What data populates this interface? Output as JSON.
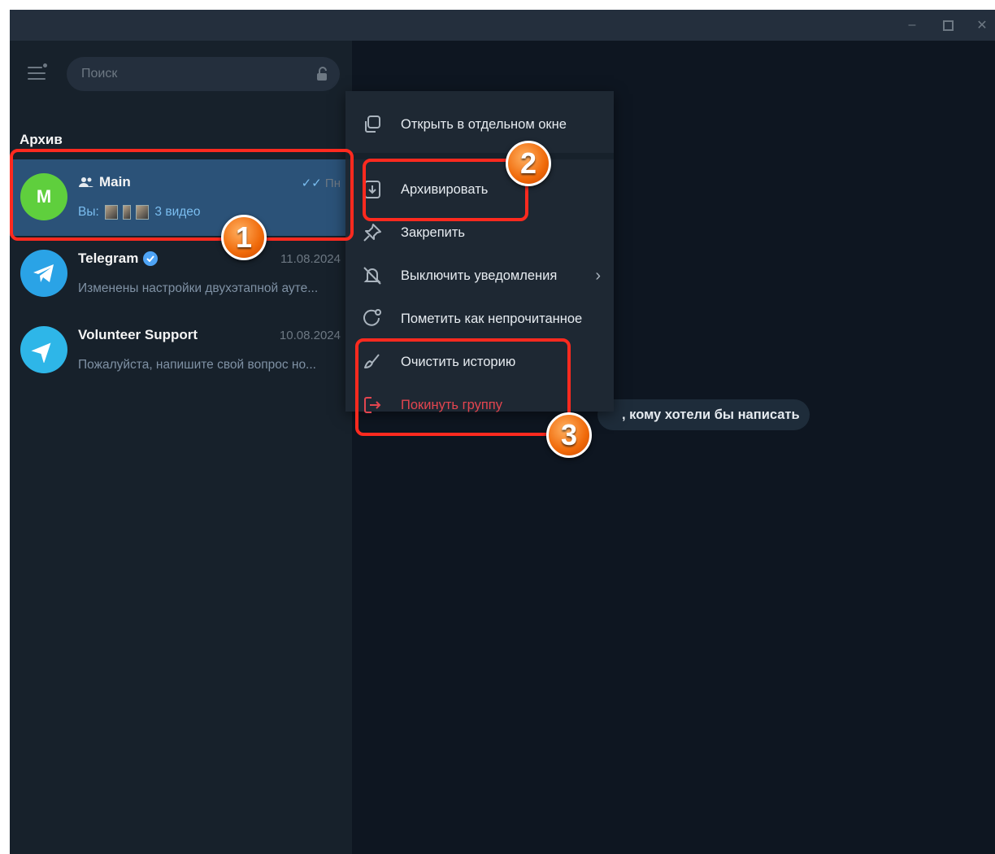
{
  "window": {
    "controls": {
      "minimize": "–",
      "close": "✕"
    }
  },
  "sidebar": {
    "search": {
      "placeholder": "Поиск"
    },
    "section_title": "Архив",
    "chats": [
      {
        "name": "Main",
        "date": "Пн",
        "avatar_letter": "M",
        "avatar_color": "#5fcf3d",
        "preview_prefix": "Вы:",
        "preview_text": "3 видео",
        "is_group": true,
        "active": true
      },
      {
        "name": "Telegram",
        "date": "11.08.2024",
        "avatar_color": "#2aa3e6",
        "preview_text": "Изменены настройки двухэтапной ауте...",
        "verified": true
      },
      {
        "name": "Volunteer Support",
        "date": "10.08.2024",
        "avatar_color": "#2eb6e8",
        "preview_text": "Пожалуйста, напишите свой вопрос но..."
      }
    ]
  },
  "context_menu": {
    "items": [
      {
        "label": "Открыть в отдельном окне",
        "icon": "open-window-icon"
      },
      {
        "label": "Архивировать",
        "icon": "archive-icon"
      },
      {
        "label": "Закрепить",
        "icon": "pin-icon"
      },
      {
        "label": "Выключить уведомления",
        "icon": "mute-icon",
        "submenu": true
      },
      {
        "label": "Пометить как непрочитанное",
        "icon": "unread-icon"
      },
      {
        "label": "Очистить историю",
        "icon": "broom-icon"
      },
      {
        "label": "Покинуть группу",
        "icon": "leave-icon",
        "danger": true
      }
    ]
  },
  "main": {
    "hint": ", кому хотели бы написать"
  },
  "annotations": {
    "markers": [
      "1",
      "2",
      "3"
    ],
    "highlight_color": "#ff2a1f"
  }
}
